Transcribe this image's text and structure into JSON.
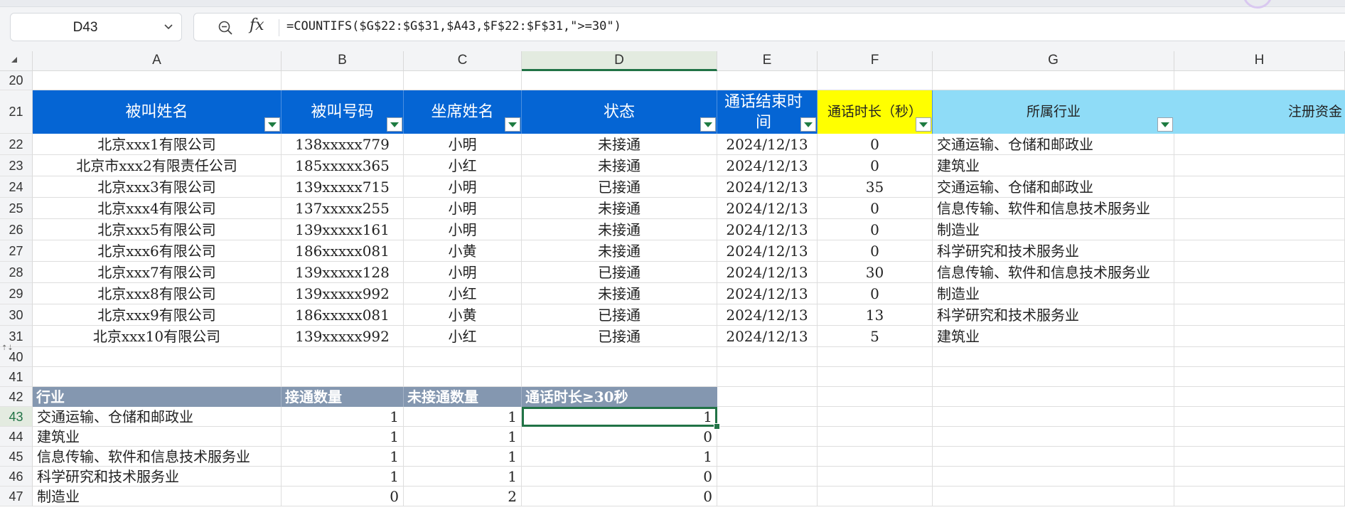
{
  "name_box": {
    "value": "D43"
  },
  "formula_bar": {
    "formula": "=COUNTIFS($G$22:$G$31,$A43,$F$22:$F$31,\">=30\")"
  },
  "columns": [
    "A",
    "B",
    "C",
    "D",
    "E",
    "F",
    "G",
    "H"
  ],
  "rows": {
    "r20": "20",
    "r21": "21",
    "r22": "22",
    "r23": "23",
    "r24": "24",
    "r25": "25",
    "r26": "26",
    "r27": "27",
    "r28": "28",
    "r29": "29",
    "r30": "30",
    "r31": "31",
    "r40": "40",
    "r41": "41",
    "r42": "42",
    "r43": "43",
    "r44": "44",
    "r45": "45",
    "r46": "46",
    "r47": "47"
  },
  "table_header": {
    "callee_name": "被叫姓名",
    "callee_number": "被叫号码",
    "agent_name": "坐席姓名",
    "status": "状态",
    "call_end_time": "通话结束时间",
    "call_duration": "通话时长（秒）",
    "industry": "所属行业",
    "registered_capital": "注册资金"
  },
  "table_rows": [
    {
      "name": "北京xxx1有限公司",
      "number": "138xxxxx779",
      "agent": "小明",
      "status": "未接通",
      "date": "2024/12/13",
      "duration": "0",
      "industry": "交通运输、仓储和邮政业"
    },
    {
      "name": "北京市xxx2有限责任公司",
      "number": "185xxxxx365",
      "agent": "小红",
      "status": "未接通",
      "date": "2024/12/13",
      "duration": "0",
      "industry": "建筑业"
    },
    {
      "name": "北京xxx3有限公司",
      "number": "139xxxxx715",
      "agent": "小明",
      "status": "已接通",
      "date": "2024/12/13",
      "duration": "35",
      "industry": "交通运输、仓储和邮政业"
    },
    {
      "name": "北京xxx4有限公司",
      "number": "137xxxxx255",
      "agent": "小明",
      "status": "未接通",
      "date": "2024/12/13",
      "duration": "0",
      "industry": "信息传输、软件和信息技术服务业"
    },
    {
      "name": "北京xxx5有限公司",
      "number": "139xxxxx161",
      "agent": "小明",
      "status": "未接通",
      "date": "2024/12/13",
      "duration": "0",
      "industry": "制造业"
    },
    {
      "name": "北京xxx6有限公司",
      "number": "186xxxxx081",
      "agent": "小黄",
      "status": "未接通",
      "date": "2024/12/13",
      "duration": "0",
      "industry": "科学研究和技术服务业"
    },
    {
      "name": "北京xxx7有限公司",
      "number": "139xxxxx128",
      "agent": "小明",
      "status": "已接通",
      "date": "2024/12/13",
      "duration": "30",
      "industry": "信息传输、软件和信息技术服务业"
    },
    {
      "name": "北京xxx8有限公司",
      "number": "139xxxxx992",
      "agent": "小红",
      "status": "未接通",
      "date": "2024/12/13",
      "duration": "0",
      "industry": "制造业"
    },
    {
      "name": "北京xxx9有限公司",
      "number": "186xxxxx081",
      "agent": "小黄",
      "status": "已接通",
      "date": "2024/12/13",
      "duration": "13",
      "industry": "科学研究和技术服务业"
    },
    {
      "name": "北京xxx10有限公司",
      "number": "139xxxxx992",
      "agent": "小红",
      "status": "已接通",
      "date": "2024/12/13",
      "duration": "5",
      "industry": "建筑业"
    }
  ],
  "summary_header": {
    "industry": "行业",
    "connected_count": "接通数量",
    "not_connected_count": "未接通数量",
    "duration_ge_30": "通话时长≥30秒"
  },
  "summary_rows": [
    {
      "industry": "交通运输、仓储和邮政业",
      "connected": "1",
      "not_connected": "1",
      "ge30": "1"
    },
    {
      "industry": "建筑业",
      "connected": "1",
      "not_connected": "1",
      "ge30": "0"
    },
    {
      "industry": "信息传输、软件和信息技术服务业",
      "connected": "1",
      "not_connected": "1",
      "ge30": "1"
    },
    {
      "industry": "科学研究和技术服务业",
      "connected": "1",
      "not_connected": "1",
      "ge30": "0"
    },
    {
      "industry": "制造业",
      "connected": "0",
      "not_connected": "2",
      "ge30": "0"
    }
  ],
  "colors": {
    "header_blue": "#0565d4",
    "header_yellow": "#ffff00",
    "header_lightblue": "#8fdcf7",
    "summary_header": "#8497b0",
    "selection_green": "#217346"
  },
  "icons": {
    "zoom": "zoom-icon",
    "fx": "fx-icon",
    "chevron": "chevron-down-icon",
    "filter": "filter-dropdown-icon"
  }
}
